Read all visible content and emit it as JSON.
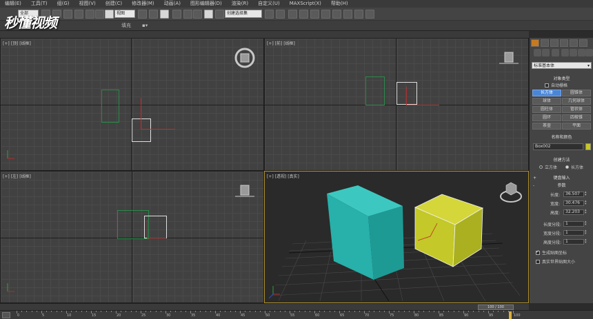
{
  "menubar": {
    "items": [
      "编辑(E)",
      "工具(T)",
      "组(G)",
      "视图(V)",
      "创建(C)",
      "修改器(M)",
      "动画(A)",
      "图形编辑器(D)",
      "渲染(R)",
      "自定义(U)",
      "MAXScript(X)",
      "帮助(H)"
    ]
  },
  "toolbar": {
    "selection_filter": "全部",
    "view_dropdown": "视图",
    "named_selection": "创建选择集"
  },
  "toolbar2": {
    "fill_label": "填充"
  },
  "watermark": "秒懂视频",
  "viewports": {
    "top": {
      "label": "[+] [顶] [线框]"
    },
    "front": {
      "label": "[+] [前] [线框]"
    },
    "left": {
      "label": "[+] [左] [线框]"
    },
    "perspective": {
      "label": "[+] [透视] [真实]"
    }
  },
  "command_panel": {
    "category": "标准基本体",
    "object_type": {
      "title": "对象类型",
      "autogrid_label": "自动栅格",
      "buttons": [
        "长方体",
        "圆锥体",
        "球体",
        "几何球体",
        "圆柱体",
        "管状体",
        "圆环",
        "四棱锥",
        "茶壶",
        "平面"
      ],
      "active_button": "长方体"
    },
    "name_color": {
      "title": "名称和颜色",
      "name_value": "Box002",
      "object_color": "#c8c820"
    },
    "creation_method": {
      "title": "创建方法",
      "cube_label": "立方体",
      "box_label": "长方体"
    },
    "keyboard_input": {
      "title": "键盘输入"
    },
    "parameters": {
      "title": "参数",
      "length_label": "长度:",
      "length_value": "36.507",
      "width_label": "宽度:",
      "width_value": "30.476",
      "height_label": "高度:",
      "height_value": "32.203",
      "length_segs_label": "长度分段:",
      "length_segs_value": "1",
      "width_segs_label": "宽度分段:",
      "width_segs_value": "1",
      "height_segs_label": "高度分段:",
      "height_segs_value": "1",
      "gen_map_label": "生成贴图坐标",
      "real_world_label": "真实世界贴图大小"
    }
  },
  "timeline": {
    "slider_label": "100 / 100",
    "ticks": [
      "0",
      "5",
      "10",
      "15",
      "20",
      "25",
      "30",
      "35",
      "40",
      "45",
      "50",
      "55",
      "60",
      "65",
      "70",
      "75",
      "80",
      "85",
      "90",
      "95",
      "100"
    ]
  },
  "colors": {
    "teal_box": "#2ab8b0",
    "yellow_box": "#c8cc2a",
    "active_blue": "#4a86d8",
    "viewport_active_border": "#b0922c"
  }
}
